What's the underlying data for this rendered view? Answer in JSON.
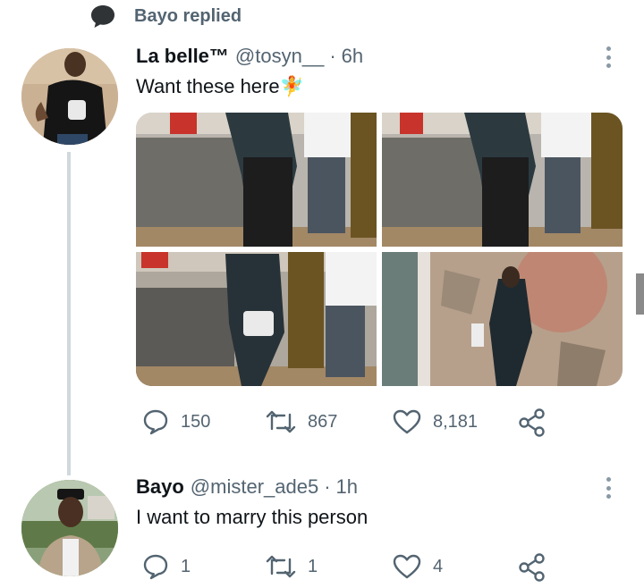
{
  "reply_banner": {
    "icon": "speech-bubble-icon",
    "text": "Bayo replied"
  },
  "tweets": [
    {
      "name": "La belle™",
      "handle": "@tosyn__",
      "separator": "·",
      "time": "6h",
      "text": "Want these here🧚",
      "actions": {
        "replies": "150",
        "retweets": "867",
        "likes": "8,181"
      }
    },
    {
      "name": "Bayo",
      "handle": "@mister_ade5",
      "separator": "·",
      "time": "1h",
      "text": "I want to marry this person",
      "actions": {
        "replies": "1",
        "retweets": "1",
        "likes": "4"
      }
    }
  ],
  "colors": {
    "text": "#0f1419",
    "muted": "#536471",
    "thread_line": "#cfd9de"
  }
}
